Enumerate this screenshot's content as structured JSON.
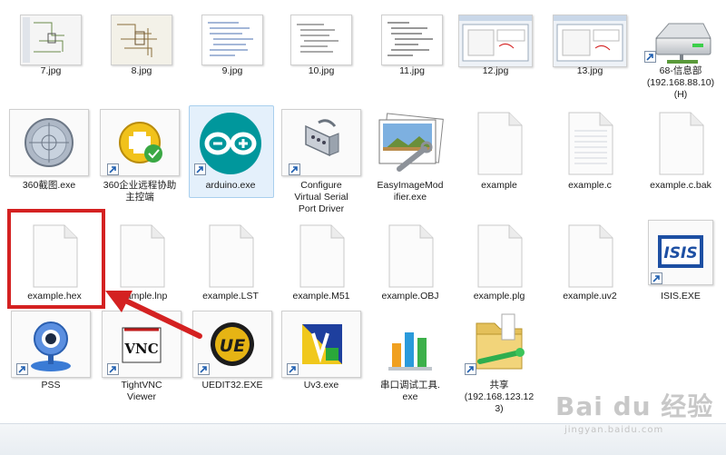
{
  "row1": {
    "labels": [
      "7.jpg",
      "8.jpg",
      "9.jpg",
      "10.jpg",
      "11.jpg",
      "12.jpg",
      "13.jpg"
    ],
    "drive_label": "68-信息部\n(192.168.88.10)\n(H)"
  },
  "row2": {
    "labels": [
      "360截图.exe",
      "360企业远程协助\n主控端",
      "arduino.exe",
      "Configure\nVirtual Serial\nPort Driver",
      "EasyImageMod\nifier.exe",
      "example",
      "example.c",
      "example.c.bak"
    ]
  },
  "row3": {
    "labels": [
      "example.hex",
      "example.lnp",
      "example.LST",
      "example.M51",
      "example.OBJ",
      "example.plg",
      "example.uv2",
      "ISIS.EXE"
    ],
    "isis_logo_text": "ISIS"
  },
  "row4": {
    "labels": [
      "PSS",
      "TightVNC\nViewer",
      "UEDIT32.EXE",
      "Uv3.exe",
      "串口调试工具.\nexe",
      "共享\n(192.168.123.12\n3)"
    ],
    "vnc_logo_text": "VNC",
    "ue_logo_text": "UE"
  },
  "watermark": {
    "text": "Bai du 经验",
    "url": "jingyan.baidu.com"
  },
  "colors": {
    "highlight_red": "#d42121",
    "selection_blue": "#cde4f7",
    "arduino_teal": "#00979c"
  }
}
